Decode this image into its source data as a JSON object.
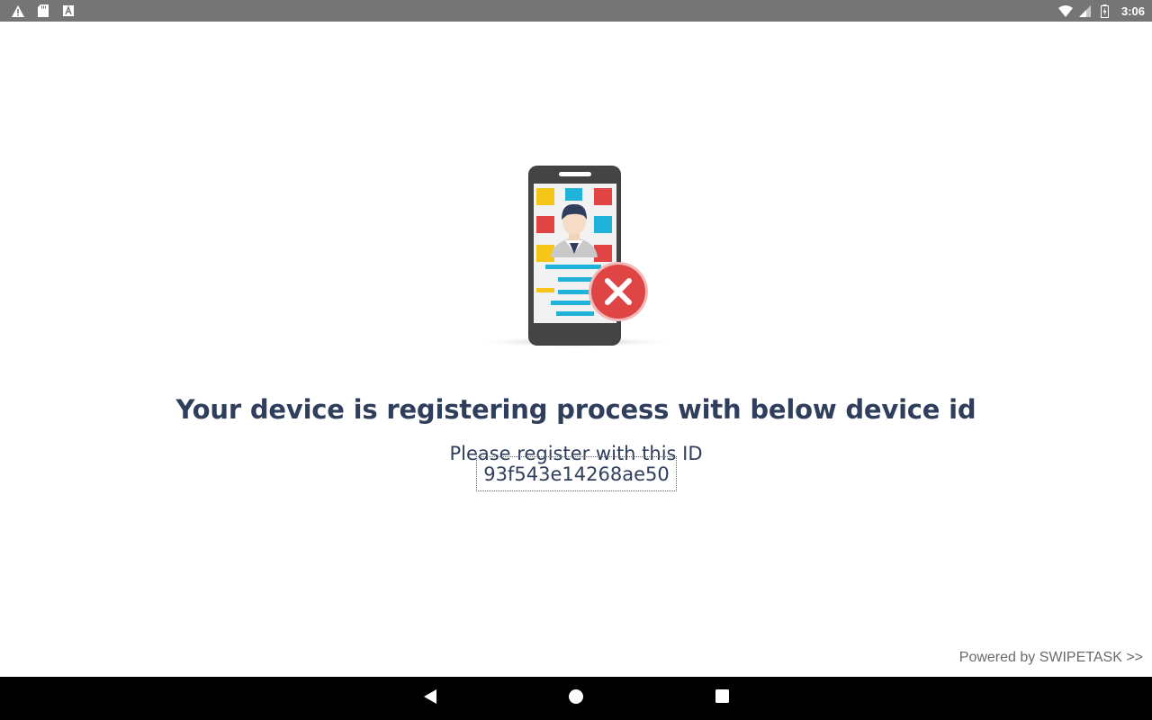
{
  "status_bar": {
    "time": "3:06",
    "left_icons": [
      "warning-icon",
      "sd-card-icon",
      "keyboard-a-icon"
    ],
    "right_icons": [
      "wifi-icon",
      "signal-icon",
      "battery-charging-icon"
    ],
    "background": "#757575"
  },
  "main": {
    "illustration_icon": "phone-registration-error-icon",
    "headline": "Your device is registering process with below device id",
    "subtitle": "Please register with this ID",
    "device_id": "93f543e14268ae50",
    "text_color": "#2f3e5c",
    "powered_by": "Powered by SWIPETASK >>"
  },
  "nav_bar": {
    "buttons": [
      "back-icon",
      "home-icon",
      "recents-icon"
    ],
    "background": "#000000"
  }
}
